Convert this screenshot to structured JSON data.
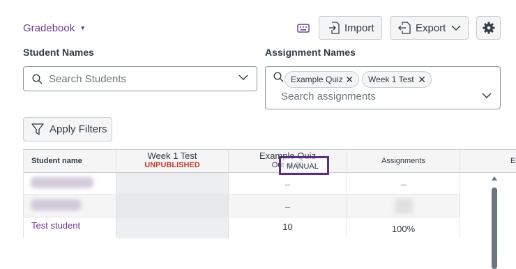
{
  "header": {
    "gradebook_menu": "Gradebook",
    "import_label": "Import",
    "export_label": "Export"
  },
  "filters": {
    "student_names_label": "Student Names",
    "assignment_names_label": "Assignment Names",
    "student_search_placeholder": "Search Students",
    "assignment_search_placeholder": "Search assignments",
    "tags": [
      "Example Quiz",
      "Week 1 Test"
    ],
    "apply_label": "Apply Filters"
  },
  "grid": {
    "headers": {
      "student_name": "Student name",
      "week1_title": "Week 1 Test",
      "week1_status": "UNPUBLISHED",
      "quiz_title": "Example Quiz",
      "quiz_sub": "Out of 10",
      "assignments": "Assignments",
      "extra": "Ex"
    },
    "manual_badge": "MANUAL",
    "rows": [
      {
        "name": "",
        "quiz": "–",
        "assign": "–"
      },
      {
        "name": "",
        "quiz": "–",
        "assign": ""
      },
      {
        "name": "Test student",
        "quiz": "10",
        "assign": "100%"
      }
    ]
  },
  "icons": {
    "gradebook_caret": "caret-down-icon",
    "keyboard": "keyboard-icon",
    "import": "import-icon",
    "export": "export-icon",
    "settings": "gear-icon",
    "search": "search-icon",
    "filter": "filter-icon"
  },
  "colors": {
    "link": "#6b3a8f",
    "unpublished": "#c23c2d",
    "highlight_border": "#5a2d82"
  }
}
